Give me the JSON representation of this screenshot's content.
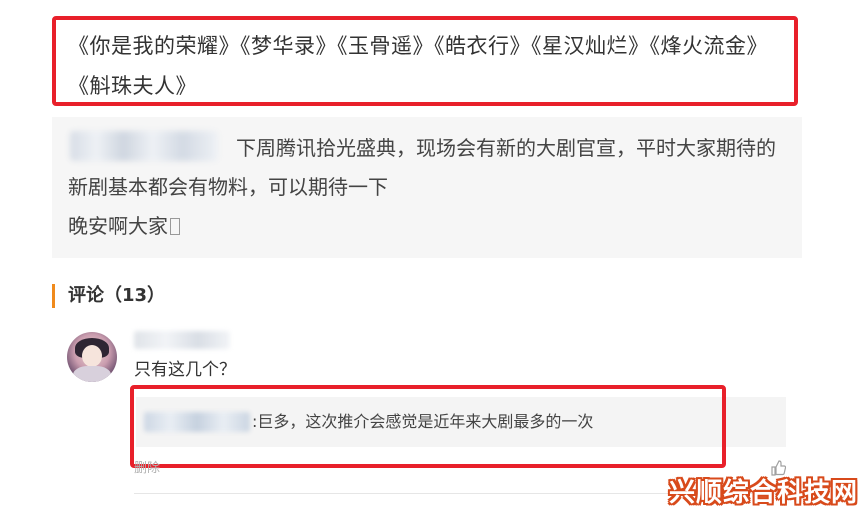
{
  "post": {
    "title": "《你是我的荣耀》《梦华录》《玉骨遥》《皓衣行》《星汉灿烂》《烽火流金》《斛珠夫人》"
  },
  "quote": {
    "line1": "下周腾讯拾光盛典，现场会有新的大剧官宣，平时大家期待的新剧基本都会有物料，可以期待一下",
    "line2": "晚安啊大家"
  },
  "comments": {
    "header": "评论（13）",
    "items": [
      {
        "text": "只有这几个？",
        "reply": ":巨多，这次推介会感觉是近年来大剧最多的一次",
        "action": "删除"
      }
    ]
  },
  "watermark": "兴顺综合科技网",
  "icons": {
    "like": "thumbs-up-icon"
  },
  "colors": {
    "highlight": "#e8202a",
    "accent": "#f08a1c",
    "quote_bg": "#f6f6f6"
  }
}
